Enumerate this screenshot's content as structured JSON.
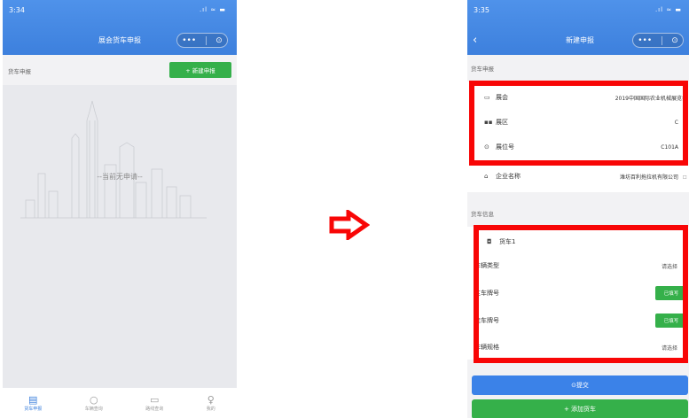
{
  "left": {
    "time": "3:34",
    "status_icons": ".ıl ≈ ▬",
    "title": "展会货车申报",
    "capsule_more": "•••",
    "capsule_close": "⊙",
    "section": "货车申报",
    "new_button": "+ 新建申报",
    "empty_text": "--当前无申请--",
    "tabs": [
      {
        "icon": "▤",
        "label": "货车申报"
      },
      {
        "icon": "○",
        "label": "车辆查询"
      },
      {
        "icon": "▭",
        "label": "路线查询"
      },
      {
        "icon": "♀",
        "label": "我的"
      }
    ]
  },
  "arrow_color": "#f80606",
  "right": {
    "time": "3:35",
    "status_icons": ".ıl ≈ ▬",
    "back": "‹",
    "title": "新建申报",
    "capsule_more": "•••",
    "capsule_close": "⊙",
    "section1": "货车申报",
    "fields": [
      {
        "icon": "▭",
        "label": "展会",
        "value": "2019中国国际农业机械展览会"
      },
      {
        "icon": "▪▪",
        "label": "展区",
        "value": "C"
      },
      {
        "icon": "⊙",
        "label": "展位号",
        "value": "C101A"
      },
      {
        "icon": "⌂",
        "label": "企业名称",
        "value": "潍坊百利拖拉机有限公司"
      }
    ],
    "section2": "货车信息",
    "truck_title": "货车1",
    "truck_icon": "◘",
    "vehicle_rows": [
      {
        "label": "车辆类型",
        "value": "请选择"
      },
      {
        "label": "主车牌号",
        "value": "已填写"
      },
      {
        "label": "挂车牌号",
        "value": "已填写"
      },
      {
        "label": "车辆规格",
        "value": "请选择"
      }
    ],
    "submit": "⊙提交",
    "add": "+ 添加货车"
  }
}
